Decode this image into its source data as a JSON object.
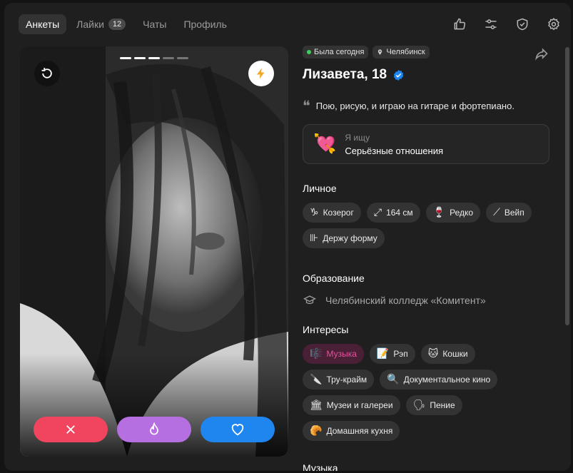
{
  "nav": {
    "tabs": [
      {
        "label": "Анкеты"
      },
      {
        "label": "Лайки",
        "badge": "12"
      },
      {
        "label": "Чаты"
      },
      {
        "label": "Профиль"
      }
    ]
  },
  "status": {
    "online": "Была сегодня",
    "city": "Челябинск"
  },
  "profile": {
    "name": "Лизавета, 18",
    "bio": "Пою, рисую, и играю на гитаре и фортепиано."
  },
  "seeking": {
    "label": "Я ищу",
    "value": "Серьёзные отношения",
    "emoji": "💘"
  },
  "personal": {
    "title": "Личное",
    "chips": [
      {
        "icon": "♑",
        "label": "Козерог"
      },
      {
        "icon": "⤢",
        "label": "164 см"
      },
      {
        "icon": "🍷",
        "label": "Редко"
      },
      {
        "icon": "⟋",
        "label": "Вейп"
      },
      {
        "icon": "⊪",
        "label": "Держу форму"
      }
    ]
  },
  "education": {
    "title": "Образование",
    "value": "Челябинский колледж «Комитент»"
  },
  "interests": {
    "title": "Интересы",
    "chips": [
      {
        "icon": "🎼",
        "label": "Музыка"
      },
      {
        "icon": "📝",
        "label": "Рэп"
      },
      {
        "icon": "🐱",
        "label": "Кошки"
      },
      {
        "icon": "🔪",
        "label": "Тру-крайм"
      },
      {
        "icon": "🔍",
        "label": "Документальное кино"
      },
      {
        "icon": "🏛",
        "label": "Музеи и галереи"
      },
      {
        "icon": "🗣",
        "label": "Пение"
      },
      {
        "icon": "🥐",
        "label": "Домашняя кухня"
      }
    ]
  },
  "next_section": "Музыка",
  "colors": {
    "dislike": "#f1445e",
    "super": "#b56fe0",
    "like": "#1f86f0",
    "highlight": "#e0549c"
  }
}
